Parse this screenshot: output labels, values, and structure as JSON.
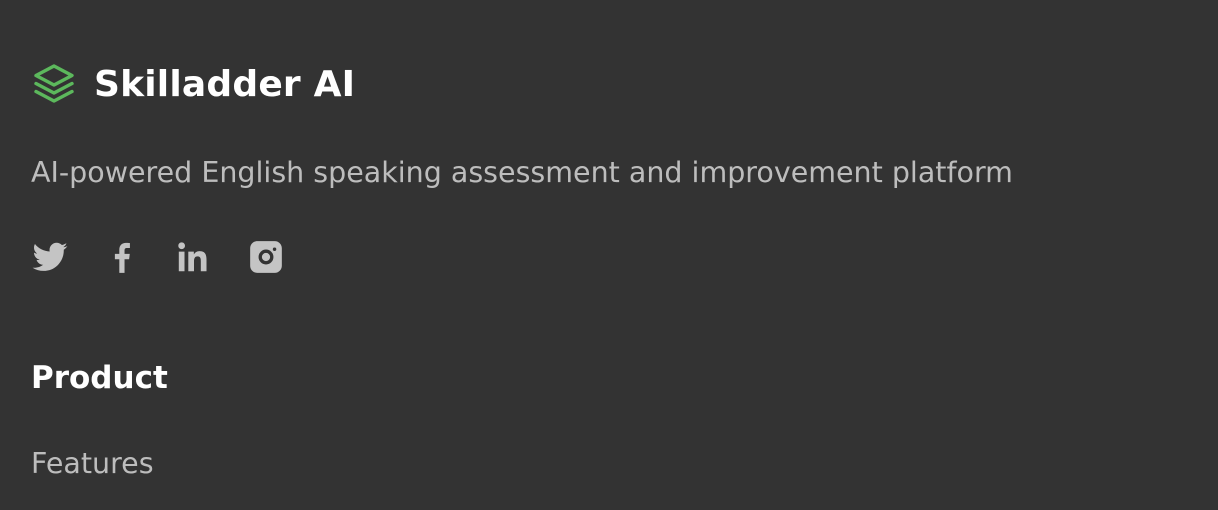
{
  "brand": {
    "name": "Skilladder AI",
    "icon": "layers-icon",
    "icon_color": "#5cb85c"
  },
  "tagline": "AI-powered English speaking assessment and improvement platform",
  "social": [
    {
      "icon": "twitter-icon"
    },
    {
      "icon": "facebook-icon"
    },
    {
      "icon": "linkedin-icon"
    },
    {
      "icon": "instagram-icon"
    }
  ],
  "product_section": {
    "title": "Product",
    "links": [
      "Features"
    ]
  },
  "colors": {
    "background": "#333333",
    "heading": "#ffffff",
    "muted_text": "#bdbdbd",
    "accent": "#5cb85c"
  }
}
